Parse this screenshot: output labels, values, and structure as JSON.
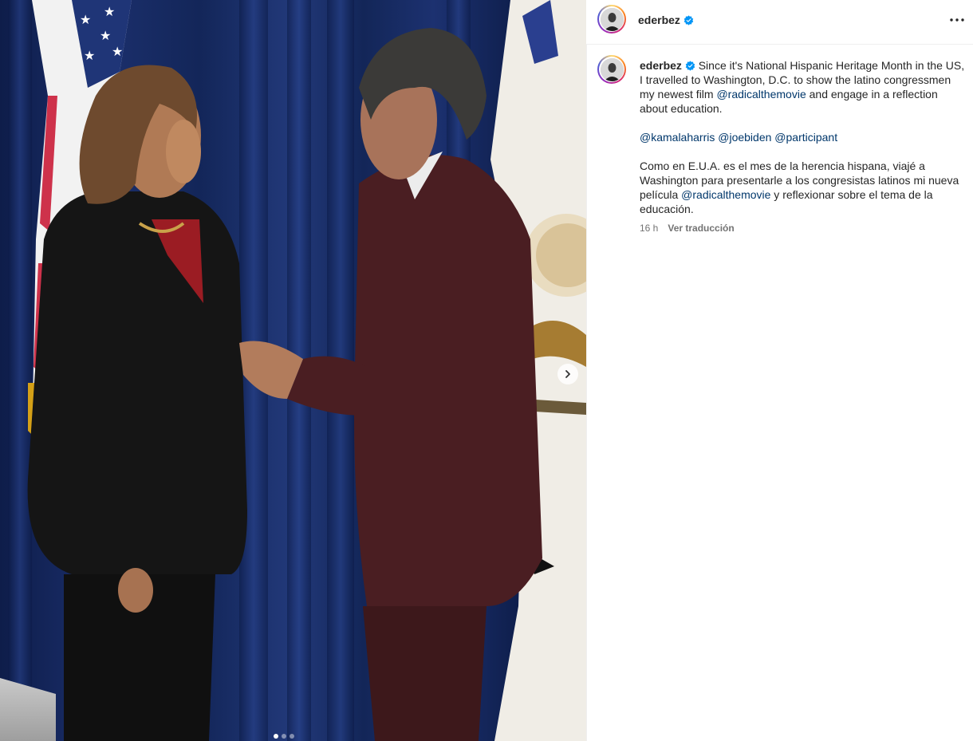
{
  "post": {
    "username": "ederbez",
    "verified": true,
    "more_icon": "more-horizontal-icon",
    "media": {
      "next_icon": "chevron-right-icon",
      "carousel_total": 3,
      "carousel_active": 1
    },
    "caption": {
      "username": "ederbez",
      "en_part1": "Since it's National Hispanic Heritage Month in the US, I travelled to Washington, D.C. to show the latino congressmen my newest film ",
      "en_mention": "@radicalthemovie",
      "en_part2": " and engage in a reflection about education.",
      "mentions": [
        "@kamalaharris",
        "@joebiden",
        "@participant"
      ],
      "es_part1": "Como en E.U.A. es el mes de la herencia hispana, viajé a Washington para presentarle a los congresistas latinos mi nueva película ",
      "es_mention": "@radicalthemovie",
      "es_part2": " y reflexionar sobre el tema de la educación."
    },
    "timestamp": "16 h",
    "translate_label": "Ver traducción"
  },
  "colors": {
    "verified_blue": "#0095f6",
    "mention_blue": "#00376b",
    "meta_gray": "#737373",
    "curtain_blue": "#1b2f6c"
  }
}
